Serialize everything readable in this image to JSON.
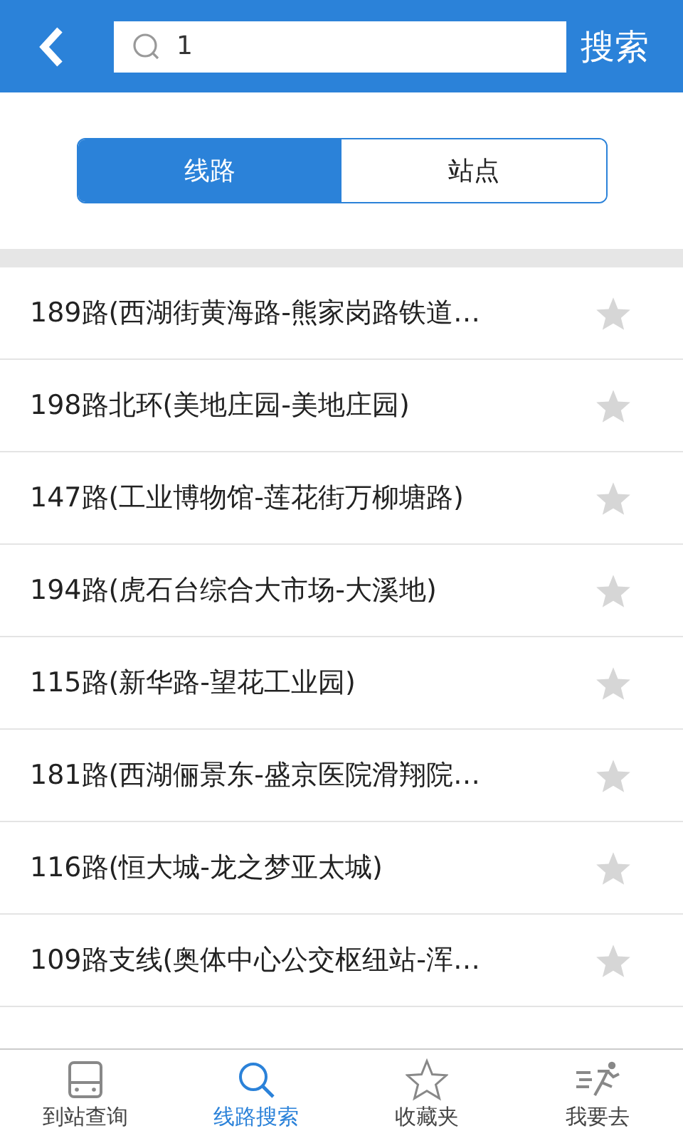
{
  "header": {
    "search_value": "1",
    "search_button": "搜索"
  },
  "segments": [
    {
      "label": "线路",
      "selected": true
    },
    {
      "label": "站点",
      "selected": false
    }
  ],
  "routes": [
    {
      "name": "189路(西湖街黄海路-熊家岗路铁道…",
      "favorite": false
    },
    {
      "name": "198路北环(美地庄园-美地庄园)",
      "favorite": false
    },
    {
      "name": "147路(工业博物馆-莲花街万柳塘路)",
      "favorite": false
    },
    {
      "name": "194路(虎石台综合大市场-大溪地)",
      "favorite": false
    },
    {
      "name": "115路(新华路-望花工业园)",
      "favorite": false
    },
    {
      "name": "181路(西湖俪景东-盛京医院滑翔院…",
      "favorite": false
    },
    {
      "name": "116路(恒大城-龙之梦亚太城)",
      "favorite": false
    },
    {
      "name": "109路支线(奥体中心公交枢纽站-浑…",
      "favorite": false
    }
  ],
  "tabs": [
    {
      "kind": "bus",
      "label": "到站查询",
      "selected": false
    },
    {
      "kind": "search",
      "label": "线路搜索",
      "selected": true
    },
    {
      "kind": "star",
      "label": "收藏夹",
      "selected": false
    },
    {
      "kind": "run",
      "label": "我要去",
      "selected": false
    }
  ]
}
